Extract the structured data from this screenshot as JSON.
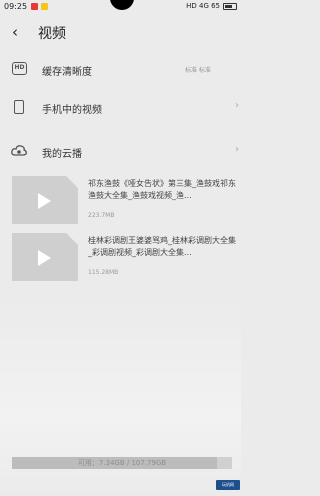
{
  "status_bar": {
    "time": "09:25",
    "right_text": "HD 4G 65"
  },
  "header": {
    "back_icon": "back-arrow-icon",
    "title": "视频"
  },
  "menu": {
    "cache_quality": {
      "icon": "hd-icon",
      "icon_text": "HD",
      "label": "缓存清晰度",
      "value": "标准 标准"
    },
    "phone_videos": {
      "icon": "phone-icon",
      "label": "手机中的视频",
      "chevron": "›"
    },
    "cloud": {
      "icon": "cloud-icon",
      "label": "我的云播",
      "chevron": "›"
    }
  },
  "videos": [
    {
      "title": "祁东渔鼓《哑女告状》第三集_渔鼓戏祁东渔鼓大全集_渔鼓戏视频_渔...",
      "size": "223.7MB"
    },
    {
      "title": "桂林彩调剧王婆婆骂鸡_桂林彩调剧大全集_彩调剧视频_彩调剧大全集...",
      "size": "115.28MB"
    }
  ],
  "storage": {
    "text": "可用：7.34GB / 107.79GB",
    "fraction_used": 0.93
  },
  "watermark": {
    "text": "玩机网"
  }
}
